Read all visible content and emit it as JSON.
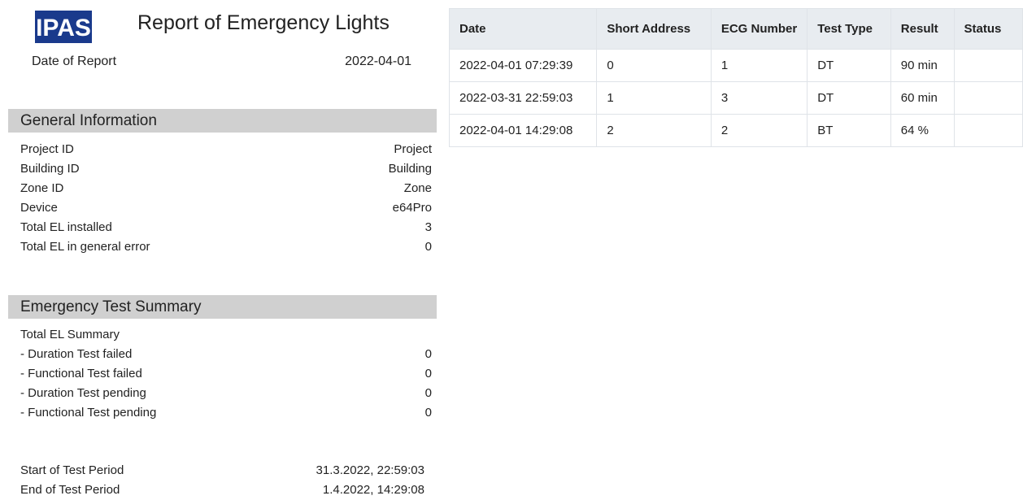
{
  "header": {
    "logo_text": "IPAS",
    "title": "Report of Emergency Lights",
    "date_label": "Date of Report",
    "date_value": "2022-04-01"
  },
  "general": {
    "heading": "General Information",
    "rows": [
      {
        "label": "Project ID",
        "value": "Project"
      },
      {
        "label": "Building ID",
        "value": "Building"
      },
      {
        "label": "Zone ID",
        "value": "Zone"
      },
      {
        "label": "Device",
        "value": "e64Pro"
      },
      {
        "label": "Total EL installed",
        "value": "3"
      },
      {
        "label": "Total EL in general error",
        "value": "0"
      }
    ]
  },
  "summary": {
    "heading": "Emergency Test Summary",
    "rows": [
      {
        "label": "Total EL Summary",
        "value": ""
      },
      {
        "label": "- Duration Test failed",
        "value": "0"
      },
      {
        "label": "- Functional Test failed",
        "value": "0"
      },
      {
        "label": "- Duration Test pending",
        "value": "0"
      },
      {
        "label": "- Functional Test pending",
        "value": "0"
      }
    ]
  },
  "period": {
    "start_label": "Start of Test Period",
    "start_value": "31.3.2022, 22:59:03",
    "end_label": "End of Test Period",
    "end_value": "1.4.2022, 14:29:08"
  },
  "table": {
    "columns": [
      "Date",
      "Short Address",
      "ECG Number",
      "Test Type",
      "Result",
      "Status"
    ],
    "rows": [
      [
        "2022-04-01 07:29:39",
        "0",
        "1",
        "DT",
        "90 min",
        ""
      ],
      [
        "2022-03-31 22:59:03",
        "1",
        "3",
        "DT",
        "60 min",
        ""
      ],
      [
        "2022-04-01 14:29:08",
        "2",
        "2",
        "BT",
        "64 %",
        ""
      ]
    ]
  },
  "colors": {
    "logo": "#1a3a8c",
    "section_header_bg": "#d0d0d0",
    "table_header_bg": "#e8ecf0"
  }
}
